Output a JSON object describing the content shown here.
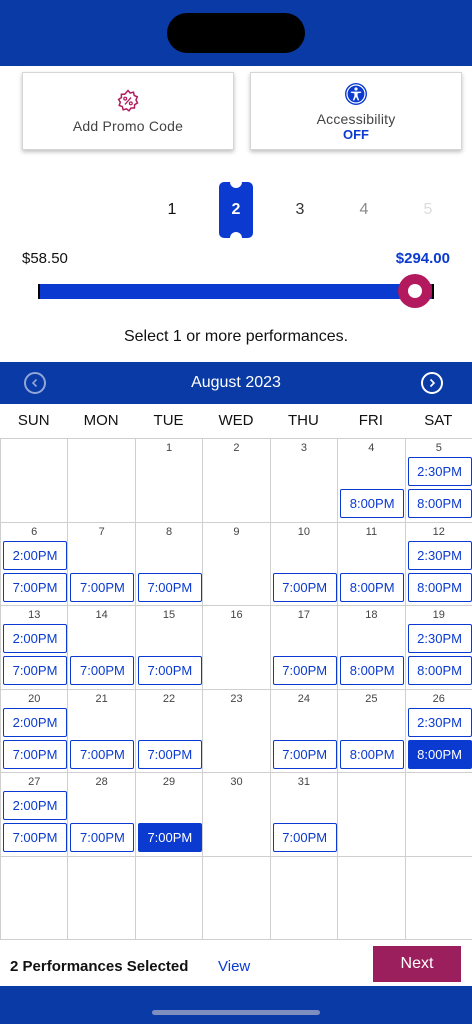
{
  "promo": {
    "label": "Add Promo Code"
  },
  "accessibility": {
    "label": "Accessibility",
    "status": "OFF"
  },
  "quantity": {
    "options": [
      "1",
      "2",
      "3",
      "4",
      "5"
    ],
    "selected": "2"
  },
  "price": {
    "min": "$58.50",
    "max": "$294.00"
  },
  "instruction": "Select 1 or more performances.",
  "calendar": {
    "month": "August 2023",
    "weekdays": [
      "SUN",
      "MON",
      "TUE",
      "WED",
      "THU",
      "FRI",
      "SAT"
    ],
    "weeks": [
      [
        {
          "day": "",
          "times": []
        },
        {
          "day": "",
          "times": []
        },
        {
          "day": "1",
          "times": []
        },
        {
          "day": "2",
          "times": []
        },
        {
          "day": "3",
          "times": []
        },
        {
          "day": "4",
          "times": [
            {
              "t": "8:00PM",
              "slot": 1
            }
          ]
        },
        {
          "day": "5",
          "times": [
            {
              "t": "2:30PM",
              "slot": 0
            },
            {
              "t": "8:00PM",
              "slot": 1
            }
          ]
        }
      ],
      [
        {
          "day": "6",
          "times": [
            {
              "t": "2:00PM",
              "slot": 0
            },
            {
              "t": "7:00PM",
              "slot": 1
            }
          ]
        },
        {
          "day": "7",
          "times": [
            {
              "t": "7:00PM",
              "slot": 1
            }
          ]
        },
        {
          "day": "8",
          "times": [
            {
              "t": "7:00PM",
              "slot": 1
            }
          ]
        },
        {
          "day": "9",
          "times": []
        },
        {
          "day": "10",
          "times": [
            {
              "t": "7:00PM",
              "slot": 1
            }
          ]
        },
        {
          "day": "11",
          "times": [
            {
              "t": "8:00PM",
              "slot": 1
            }
          ]
        },
        {
          "day": "12",
          "times": [
            {
              "t": "2:30PM",
              "slot": 0
            },
            {
              "t": "8:00PM",
              "slot": 1
            }
          ]
        }
      ],
      [
        {
          "day": "13",
          "times": [
            {
              "t": "2:00PM",
              "slot": 0
            },
            {
              "t": "7:00PM",
              "slot": 1
            }
          ]
        },
        {
          "day": "14",
          "times": [
            {
              "t": "7:00PM",
              "slot": 1
            }
          ]
        },
        {
          "day": "15",
          "times": [
            {
              "t": "7:00PM",
              "slot": 1
            }
          ]
        },
        {
          "day": "16",
          "times": []
        },
        {
          "day": "17",
          "times": [
            {
              "t": "7:00PM",
              "slot": 1
            }
          ]
        },
        {
          "day": "18",
          "times": [
            {
              "t": "8:00PM",
              "slot": 1
            }
          ]
        },
        {
          "day": "19",
          "times": [
            {
              "t": "2:30PM",
              "slot": 0
            },
            {
              "t": "8:00PM",
              "slot": 1
            }
          ]
        }
      ],
      [
        {
          "day": "20",
          "times": [
            {
              "t": "2:00PM",
              "slot": 0
            },
            {
              "t": "7:00PM",
              "slot": 1
            }
          ]
        },
        {
          "day": "21",
          "times": [
            {
              "t": "7:00PM",
              "slot": 1
            }
          ]
        },
        {
          "day": "22",
          "times": [
            {
              "t": "7:00PM",
              "slot": 1
            }
          ]
        },
        {
          "day": "23",
          "times": []
        },
        {
          "day": "24",
          "times": [
            {
              "t": "7:00PM",
              "slot": 1
            }
          ]
        },
        {
          "day": "25",
          "times": [
            {
              "t": "8:00PM",
              "slot": 1
            }
          ]
        },
        {
          "day": "26",
          "times": [
            {
              "t": "2:30PM",
              "slot": 0
            },
            {
              "t": "8:00PM",
              "slot": 1,
              "selected": true
            }
          ]
        }
      ],
      [
        {
          "day": "27",
          "times": [
            {
              "t": "2:00PM",
              "slot": 0
            },
            {
              "t": "7:00PM",
              "slot": 1
            }
          ]
        },
        {
          "day": "28",
          "times": [
            {
              "t": "7:00PM",
              "slot": 1
            }
          ]
        },
        {
          "day": "29",
          "times": [
            {
              "t": "7:00PM",
              "slot": 1,
              "selected": true
            }
          ]
        },
        {
          "day": "30",
          "times": []
        },
        {
          "day": "31",
          "times": [
            {
              "t": "7:00PM",
              "slot": 1
            }
          ]
        },
        {
          "day": "",
          "times": []
        },
        {
          "day": "",
          "times": []
        }
      ],
      [
        {
          "day": "",
          "times": []
        },
        {
          "day": "",
          "times": []
        },
        {
          "day": "",
          "times": []
        },
        {
          "day": "",
          "times": []
        },
        {
          "day": "",
          "times": []
        },
        {
          "day": "",
          "times": []
        },
        {
          "day": "",
          "times": []
        }
      ]
    ]
  },
  "footer": {
    "selected_text": "2 Performances Selected",
    "view_label": "View",
    "next_label": "Next"
  },
  "colors": {
    "brand_blue": "#0a3aa6",
    "accent_blue": "#0a3ad0",
    "accent_magenta": "#b3195d",
    "next_button": "#9c1f5d"
  }
}
